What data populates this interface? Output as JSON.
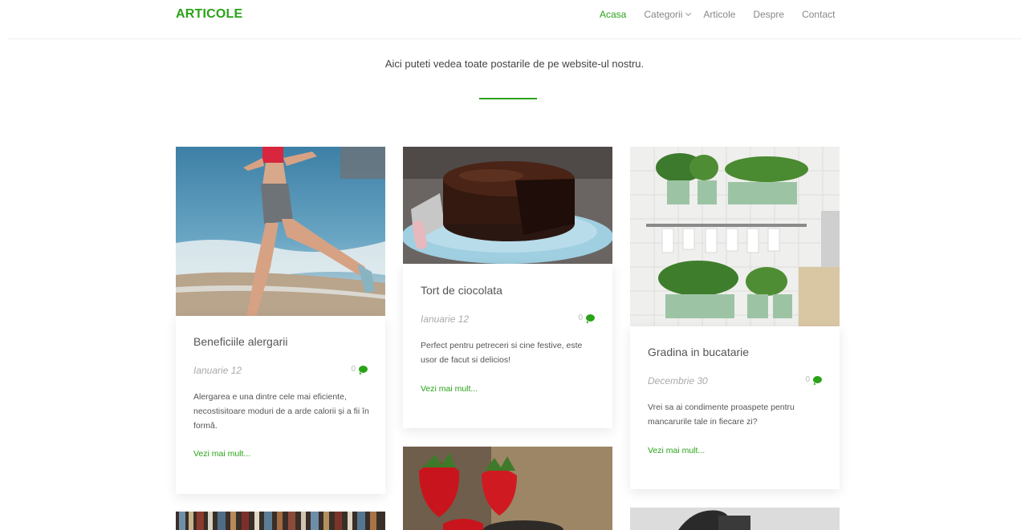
{
  "header": {
    "brand": "ARTICOLE",
    "nav": [
      {
        "label": "Acasa",
        "active": true
      },
      {
        "label": "Categorii",
        "has_dropdown": true
      },
      {
        "label": "Articole"
      },
      {
        "label": "Despre"
      },
      {
        "label": "Contact"
      }
    ]
  },
  "intro": {
    "text": "Aici puteti vedea toate postarile de pe website-ul nostru."
  },
  "posts": [
    {
      "title": "Beneficiile alergarii",
      "date": "Ianuarie 12",
      "comments": "0",
      "excerpt": "Alergarea e una dintre cele mai eficiente, necostisitoare moduri de a arde calorii și a fii în formă.",
      "more": "Vezi mai mult..."
    },
    {
      "title": "Tort de ciocolata",
      "date": "Ianuarie 12",
      "comments": "0",
      "excerpt": "Perfect pentru petreceri si cine festive, este usor de facut si delicios!",
      "more": "Vezi mai mult..."
    },
    {
      "title": "Gradina in bucatarie",
      "date": "Decembrie 30",
      "comments": "0",
      "excerpt": "Vrei sa ai condimente proaspete pentru mancarurile tale in fiecare zi?",
      "more": "Vezi mai mult..."
    }
  ],
  "colors": {
    "accent": "#2aa318"
  }
}
